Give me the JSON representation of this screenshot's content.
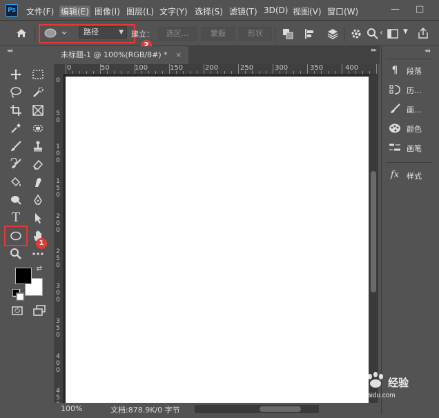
{
  "app": {
    "logo_text": "Ps"
  },
  "menu": {
    "items": [
      "文件(F)",
      "编辑(E)",
      "图像(I)",
      "图层(L)",
      "文字(Y)",
      "选择(S)",
      "滤镜(T)",
      "3D(D)",
      "视图(V)",
      "窗口(W)"
    ],
    "active_index": 1
  },
  "window_controls": {
    "minimize": "—",
    "maximize": "□"
  },
  "options_bar": {
    "mode_value": "路径",
    "make_label": "建立：",
    "selection_label": "选区...",
    "mask_label": "蒙版",
    "shape_label": "形状"
  },
  "annotations": {
    "badge_1": "1",
    "badge_2": "2",
    "highlight_color": "#e53935"
  },
  "document": {
    "tab_title": "未标题-1 @ 100%(RGB/8#) *",
    "tab_close": "×",
    "ruler_h": [
      "0",
      "50",
      "100",
      "150",
      "200",
      "250",
      "300",
      "350",
      "400"
    ],
    "ruler_v": [
      "0",
      "5 0",
      "1 0 0",
      "1 5 0",
      "2 0 0",
      "2 5 0",
      "3 0 0",
      "3 5 0",
      "4 0 0",
      "4 5 0"
    ]
  },
  "status": {
    "zoom": "100%",
    "doc_info": "文档:878.9K/0 字节"
  },
  "right_panel": {
    "items": [
      {
        "icon": "paragraph-icon",
        "label": "段落"
      },
      {
        "icon": "history-icon",
        "label": "历..."
      },
      {
        "icon": "brush-settings-icon",
        "label": "画..."
      },
      {
        "icon": "color-palette-icon",
        "label": "颜色"
      },
      {
        "icon": "brushes-icon",
        "label": "画笔"
      },
      {
        "icon": "fx-icon",
        "label": "样式"
      }
    ]
  },
  "watermark": {
    "brand": "Baidu",
    "brand_cn": "经验",
    "url": "jingyan.baidu.com"
  },
  "colors": {
    "foreground": "#000000",
    "background": "#ffffff",
    "ui_bg": "#535353"
  }
}
